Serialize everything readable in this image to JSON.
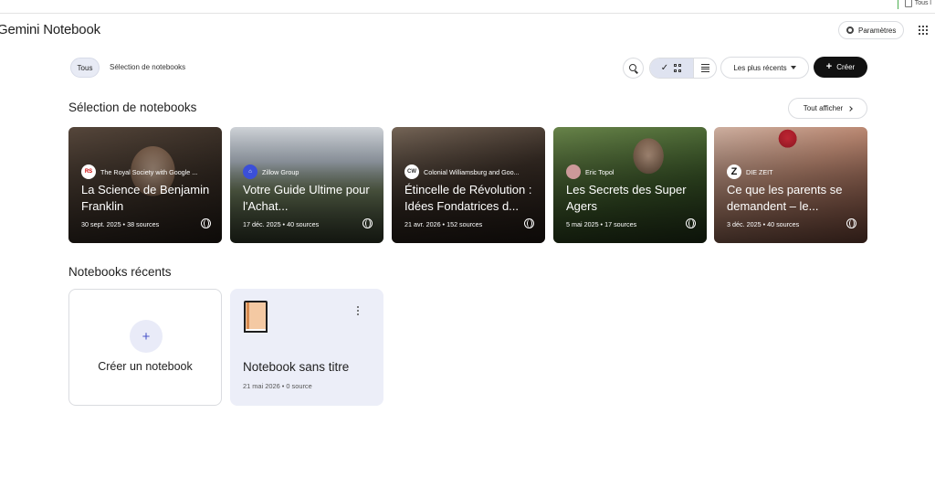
{
  "top_strip": {
    "doc_label": "Tous l"
  },
  "header": {
    "app_title": "Gemini Notebook",
    "settings_label": "Paramètres"
  },
  "filters": {
    "all_label": "Tous",
    "selection_label": "Sélection de notebooks"
  },
  "toolbar": {
    "sort_label": "Les plus récents",
    "create_label": "Créer"
  },
  "featured": {
    "title": "Sélection de notebooks",
    "see_all_label": "Tout afficher",
    "cards": [
      {
        "source": "The Royal Society with Google ...",
        "title": "La Science de Benjamin Franklin",
        "meta": "30 sept. 2025 • 38 sources"
      },
      {
        "source": "Zillow Group",
        "title": "Votre Guide Ultime pour l'Achat...",
        "meta": "17 déc. 2025 • 40 sources"
      },
      {
        "source": "Colonial Williamsburg and Goo...",
        "title": "Étincelle de Révolution : Idées Fondatrices d...",
        "meta": "21 avr. 2026 • 152 sources"
      },
      {
        "source": "Eric Topol",
        "title": "Les Secrets des Super Agers",
        "meta": "5 mai 2025 • 17 sources"
      },
      {
        "source": "DIE ZEIT",
        "title": "Ce que les parents se demandent – le...",
        "meta": "3 déc. 2025 • 40 sources"
      }
    ]
  },
  "recent": {
    "title": "Notebooks récents",
    "create_label": "Créer un notebook",
    "notebooks": [
      {
        "title": "Notebook sans titre",
        "meta": "21 mai 2026 • 0 source"
      }
    ]
  },
  "icons": {
    "settings": "gear-icon",
    "apps": "apps-grid-icon",
    "search": "search-icon",
    "grid_view": "grid-view-icon",
    "list_view": "list-view-icon",
    "public": "globe-icon"
  }
}
